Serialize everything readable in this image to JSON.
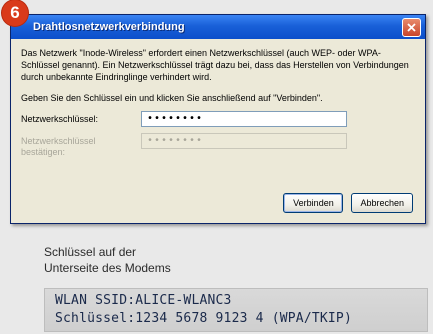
{
  "step_number": "6",
  "dialog": {
    "title": "Drahtlosnetzwerkverbindung",
    "description": "Das Netzwerk \"Inode-Wireless\" erfordert einen Netzwerkschlüssel (auch WEP- oder WPA-Schlüssel genannt). Ein Netzwerkschlüssel trägt dazu bei, dass das Herstellen von Verbindungen durch unbekannte Eindringlinge verhindert wird.",
    "instruction": "Geben Sie den Schlüssel ein und klicken Sie anschließend auf \"Verbinden\".",
    "key_label": "Netzwerkschlüssel:",
    "key_value": "••••••••",
    "confirm_label": "Netzwerkschlüssel bestätigen:",
    "confirm_value": "••••••••",
    "connect_button": "Verbinden",
    "cancel_button": "Abbrechen"
  },
  "caption": {
    "line1": "Schlüssel auf der",
    "line2": "Unterseite des Modems"
  },
  "modem_label": {
    "line1": "WLAN SSID:ALICE-WLANC3",
    "line2": "Schlüssel:1234 5678 9123 4 (WPA/TKIP)"
  },
  "colors": {
    "badge": "#d93a1a",
    "titlebar": "#1960d8",
    "dialog_bg": "#ece9d8",
    "label_text": "#1b2a4b"
  }
}
